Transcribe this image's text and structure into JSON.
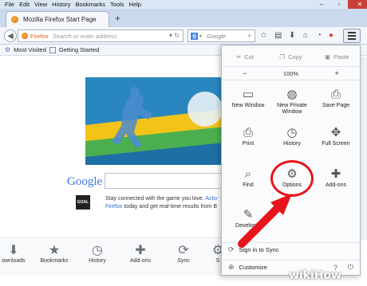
{
  "menubar": {
    "items": [
      "File",
      "Edit",
      "View",
      "History",
      "Bookmarks",
      "Tools",
      "Help"
    ]
  },
  "tab": {
    "title": "Mozilla Firefox Start Page",
    "new_tab": "+"
  },
  "navbar": {
    "url_label": "Firefox",
    "url_placeholder": "Search or enter address",
    "search_placeholder": "Google",
    "search_engine_glyph": "g"
  },
  "bookmarks": {
    "items": [
      "Most Visited",
      "Getting Started"
    ]
  },
  "content": {
    "google_logo": "Google",
    "promo_text_1": "Stay connected with the game you love.",
    "promo_link_1": "Activ",
    "promo_link_2": "Firefox",
    "promo_text_2": "today and get real-time results from B",
    "goal_badge": "GOAL"
  },
  "bottombar": {
    "items": [
      "ownloads",
      "Bookmarks",
      "History",
      "Add-ons",
      "Sync",
      "S"
    ]
  },
  "panel": {
    "cut": "Cut",
    "copy": "Copy",
    "paste": "Paste",
    "zoom_out": "−",
    "zoom_level": "100%",
    "zoom_in": "+",
    "items": [
      {
        "label": "New Window"
      },
      {
        "label": "New Private Window"
      },
      {
        "label": "Save Page"
      },
      {
        "label": "Print"
      },
      {
        "label": "History"
      },
      {
        "label": "Full Screen"
      },
      {
        "label": "Find"
      },
      {
        "label": "Options"
      },
      {
        "label": "Add-ons"
      },
      {
        "label": "Developer"
      }
    ],
    "sign_in": "Sign in to Sync",
    "customize": "Customize"
  },
  "watermark": {
    "wiki": "wiki",
    "how": "How"
  },
  "colors": {
    "annotation_red": "#e8141c",
    "firefox_orange": "#e05a1b",
    "link_blue": "#2a6ecb"
  }
}
